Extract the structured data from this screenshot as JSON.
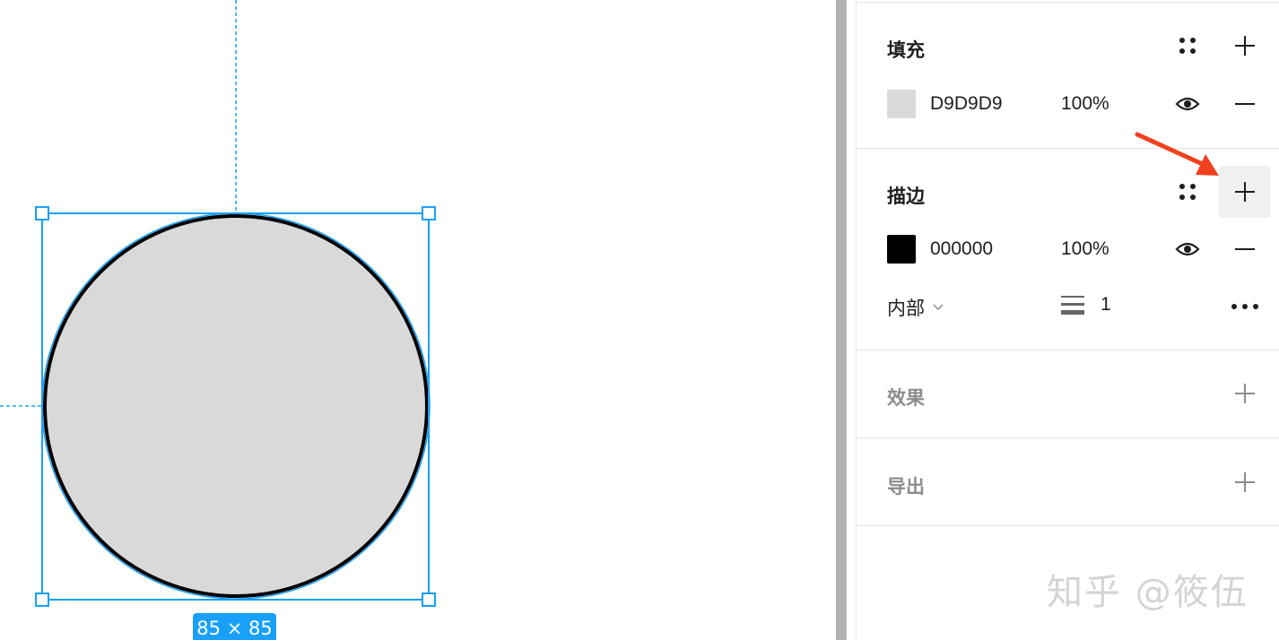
{
  "canvas": {
    "size_label": "85 × 85",
    "selection_color": "#18a0fb",
    "shape_fill": "#D9D9D9",
    "shape_stroke": "#000000"
  },
  "panel": {
    "fill": {
      "title": "填充",
      "swatch_color": "#D9D9D9",
      "hex": "D9D9D9",
      "opacity": "100%"
    },
    "stroke": {
      "title": "描边",
      "swatch_color": "#000000",
      "hex": "000000",
      "opacity": "100%",
      "position": "内部",
      "weight": "1"
    },
    "effects": {
      "title": "效果"
    },
    "export": {
      "title": "导出"
    },
    "watermark": "知乎 @筱伍",
    "annotation_arrow_color": "#f0411f"
  },
  "icons": {
    "style": "four-dots-icon",
    "add": "plus-icon",
    "remove": "minus-icon",
    "visibility": "eye-icon",
    "chevron": "chevron-down-icon",
    "stroke_weight": "stroke-weight-icon",
    "more": "more-icon"
  }
}
